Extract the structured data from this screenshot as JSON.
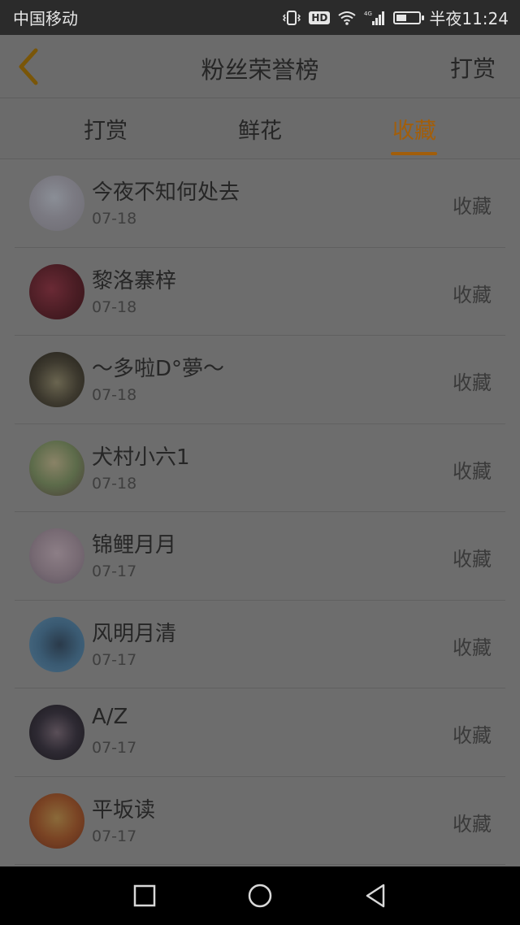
{
  "status_bar": {
    "carrier": "中国移动",
    "hd_badge": "HD",
    "network_label": "4G",
    "time": "半夜11:24",
    "icons": [
      "vibrate-icon",
      "hd-icon",
      "wifi-icon",
      "signal-icon",
      "battery-icon"
    ]
  },
  "header": {
    "title": "粉丝荣誉榜",
    "action": "打赏",
    "back_icon": "chevron-left-icon"
  },
  "tabs": [
    {
      "label": "打赏",
      "active": false
    },
    {
      "label": "鲜花",
      "active": false
    },
    {
      "label": "收藏",
      "active": true
    }
  ],
  "colors": {
    "accent": "#a25e0a",
    "overlay_background": "#6b6b6b",
    "status_bar": "#2b2b2b"
  },
  "list": [
    {
      "name": "今夜不知何处去",
      "date": "07-18",
      "action": "收藏"
    },
    {
      "name": "黎洛寨梓",
      "date": "07-18",
      "action": "收藏"
    },
    {
      "name": "～多啦D°夢～",
      "date": "07-18",
      "action": "收藏"
    },
    {
      "name": "犬村小六1",
      "date": "07-18",
      "action": "收藏"
    },
    {
      "name": "锦鲤月月",
      "date": "07-17",
      "action": "收藏"
    },
    {
      "name": "风明月清",
      "date": "07-17",
      "action": "收藏"
    },
    {
      "name": "A/Z",
      "date": "07-17",
      "action": "收藏"
    },
    {
      "name": "平坂读",
      "date": "07-17",
      "action": "收藏"
    }
  ],
  "nav": [
    "square-icon",
    "circle-icon",
    "triangle-back-icon"
  ]
}
